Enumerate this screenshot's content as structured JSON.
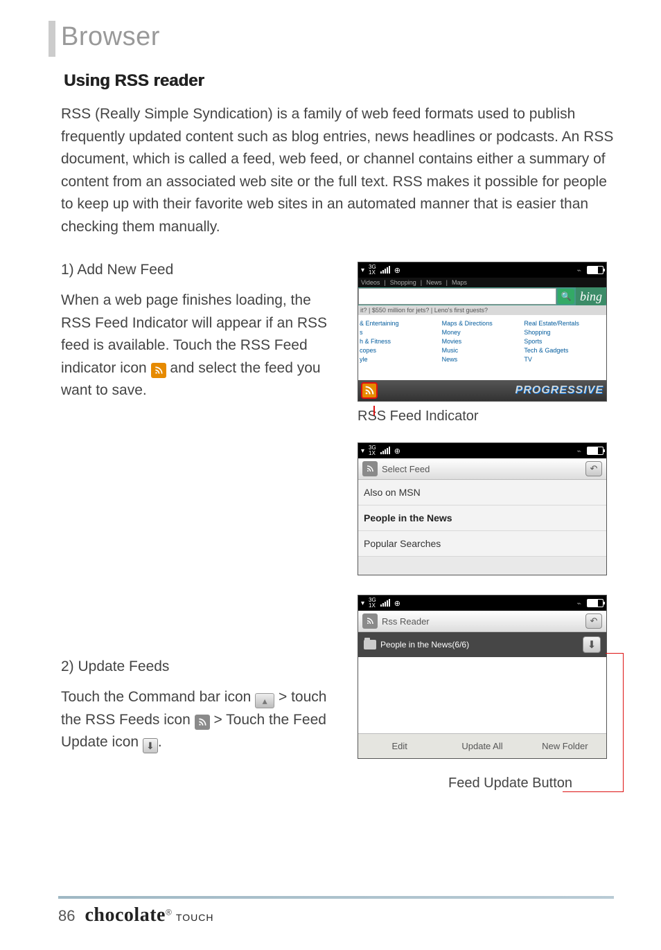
{
  "chapter": "Browser",
  "section_title": "Using RSS reader",
  "intro": "RSS (Really Simple Syndication) is a family of web feed formats used to publish frequently updated content such as blog entries, news headlines or podcasts. An RSS document, which is called a feed, web feed, or channel contains either a summary of content from an associated web site or the full text. RSS makes it possible for people to keep up with their favorite web sites in an automated manner that is easier than checking them manually.",
  "sub1": {
    "heading": "1) Add New Feed",
    "text_before_icon": "When a web page finishes loading, the RSS Feed Indicator will appear if an RSS feed is available. Touch the RSS Feed indicator icon ",
    "text_after_icon": " and select the feed you want to save."
  },
  "sub2": {
    "heading": "2) Update Feeds",
    "frag1": "Touch the Command bar icon ",
    "frag2": " > touch the RSS Feeds icon ",
    "frag3": " > Touch the Feed Update icon ",
    "period": "."
  },
  "shot1": {
    "subnav": [
      "Videos",
      "Shopping",
      "News",
      "Maps"
    ],
    "bing": "bing",
    "ticker": "it?  |  $550 million for jets?  |  Leno's first guests?",
    "col1": [
      "& Entertaining",
      "s",
      "h & Fitness",
      "copes",
      "yle"
    ],
    "col2": [
      "Maps & Directions",
      "Money",
      "Movies",
      "Music",
      "News"
    ],
    "col3": [
      "Real Estate/Rentals",
      "Shopping",
      "Sports",
      "Tech & Gadgets",
      "TV"
    ],
    "progressive": "PROGRESSIVE"
  },
  "caption1": "RSS Feed Indicator",
  "shot2": {
    "title": "Select Feed",
    "items": [
      "Also on MSN",
      "People in the News",
      "Popular Searches"
    ]
  },
  "shot3": {
    "title": "Rss Reader",
    "feed": "People in the News(6/6)",
    "footer": [
      "Edit",
      "Update All",
      "New Folder"
    ]
  },
  "caption2": "Feed Update Button",
  "page_number": "86",
  "brand": {
    "name": "chocolate",
    "reg": "®",
    "suffix": "TOUCH"
  }
}
